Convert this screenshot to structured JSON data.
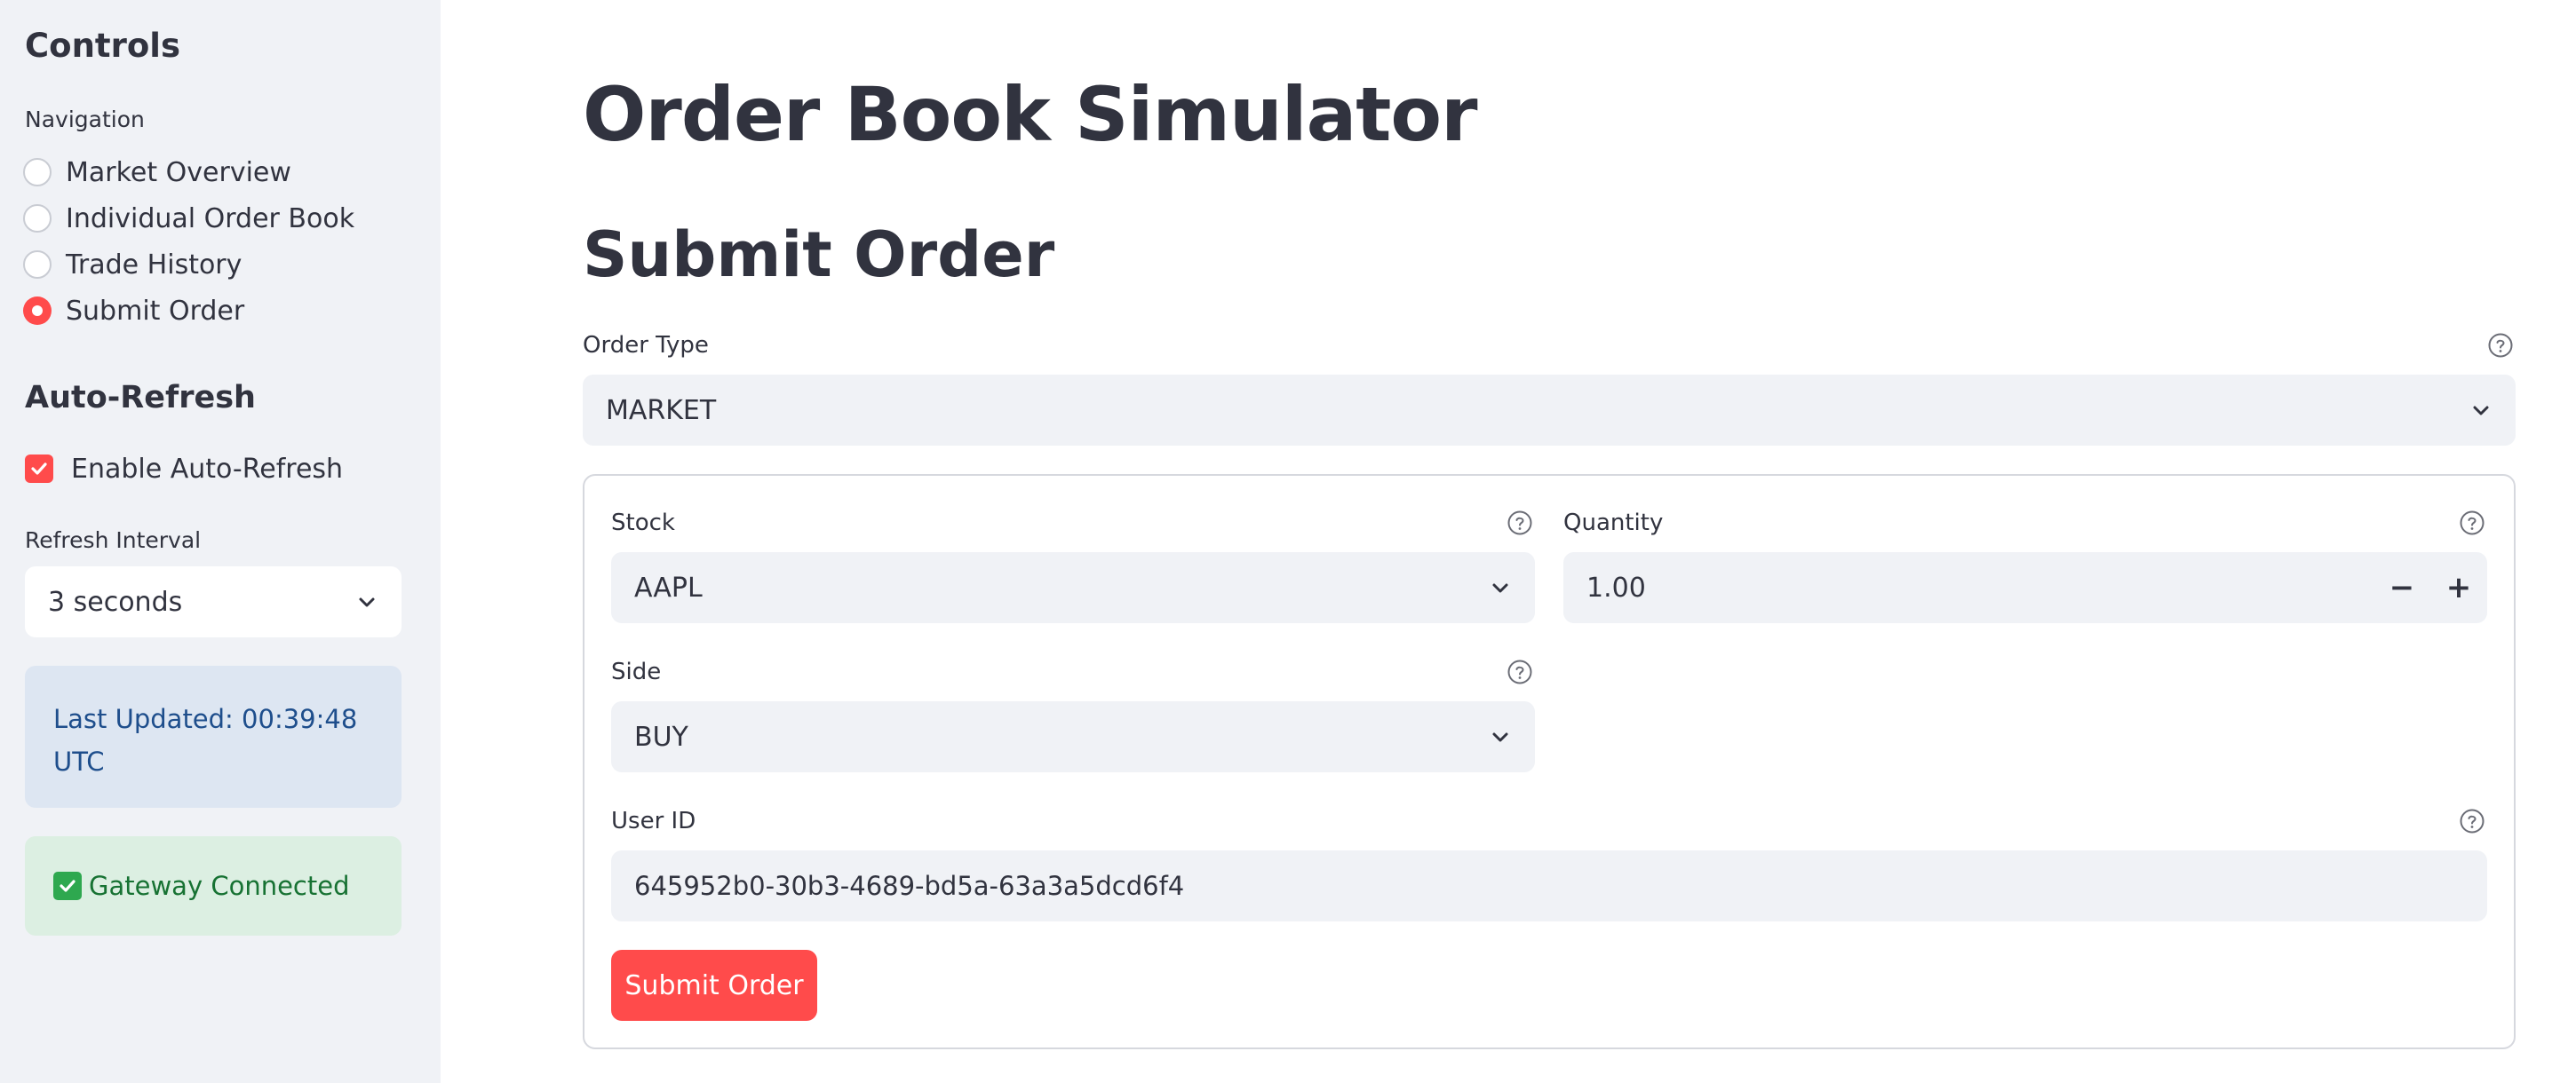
{
  "sidebar": {
    "title": "Controls",
    "navigation": {
      "label": "Navigation",
      "options": [
        "Market Overview",
        "Individual Order Book",
        "Trade History",
        "Submit Order"
      ],
      "selected": "Submit Order"
    },
    "auto_refresh": {
      "title": "Auto-Refresh",
      "enable_label": "Enable Auto-Refresh",
      "enabled": true,
      "interval_label": "Refresh Interval",
      "interval_value": "3 seconds"
    },
    "last_updated": "Last Updated: 00:39:48 UTC",
    "status": "Gateway Connected"
  },
  "main": {
    "title": "Order Book Simulator",
    "section_title": "Submit Order",
    "order_type": {
      "label": "Order Type",
      "value": "MARKET"
    },
    "form": {
      "stock": {
        "label": "Stock",
        "value": "AAPL"
      },
      "quantity": {
        "label": "Quantity",
        "value": "1.00",
        "decrement": "−",
        "increment": "+"
      },
      "side": {
        "label": "Side",
        "value": "BUY"
      },
      "user_id": {
        "label": "User ID",
        "value": "645952b0-30b3-4689-bd5a-63a3a5dcd6f4"
      },
      "submit_label": "Submit Order"
    }
  },
  "colors": {
    "accent": "#ff4b4b",
    "sidebar_bg": "#f0f2f6",
    "info_bg": "#dde6f2",
    "success_bg": "#dcefe2"
  }
}
